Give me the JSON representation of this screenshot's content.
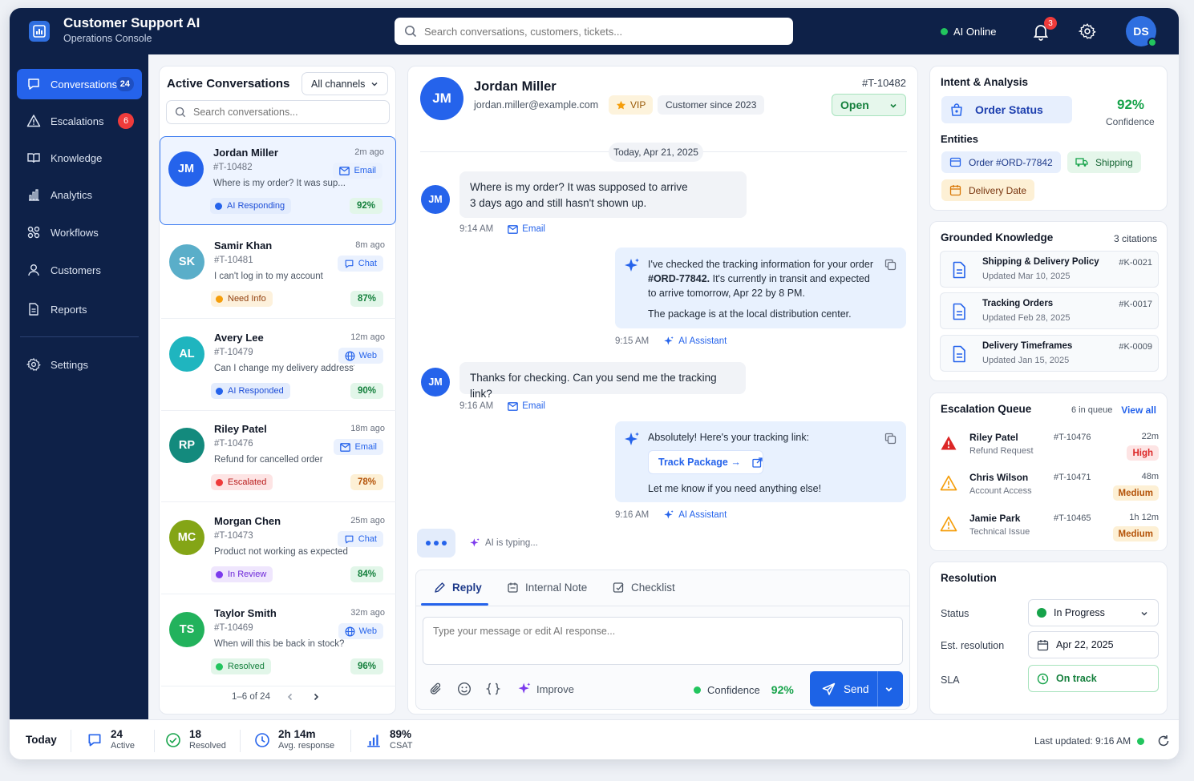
{
  "app": {
    "title": "Customer Support AI",
    "subtitle": "Operations Console"
  },
  "search": {
    "placeholder": "Search conversations, customers, tickets..."
  },
  "status": {
    "ai_label": "AI Online",
    "notifications_count": "3",
    "user_initials": "DS"
  },
  "sidebar": {
    "items": [
      {
        "label": "Conversations",
        "count": "24",
        "icon": "chat-bubble-icon",
        "active": true
      },
      {
        "label": "Escalations",
        "count": "6",
        "icon": "warning-icon"
      },
      {
        "label": "Knowledge",
        "icon": "book-icon"
      },
      {
        "label": "Analytics",
        "icon": "bar-chart-icon"
      },
      {
        "label": "Workflows",
        "icon": "workflow-icon"
      },
      {
        "label": "Customers",
        "icon": "user-icon"
      },
      {
        "label": "Reports",
        "icon": "document-icon"
      },
      {
        "label": "Settings",
        "icon": "gear-icon"
      }
    ]
  },
  "conversations": {
    "title": "Active Conversations",
    "channel_filter": "All channels",
    "search_placeholder": "Search conversations...",
    "pager": "1–6 of 24",
    "items": [
      {
        "initials": "JM",
        "name": "Jordan Miller",
        "time": "2m ago",
        "id": "#T-10482",
        "message": "Where is my order? It was sup...",
        "channel": "Email",
        "status": "AI Responding",
        "score": "92%",
        "avatar_color": "#2563eb",
        "status_color": "#2563eb",
        "status_bg": "#e3ecfd",
        "status_text": "#1d4ed8"
      },
      {
        "initials": "SK",
        "name": "Samir Khan",
        "time": "8m ago",
        "id": "#T-10481",
        "message": "I can't log in to my account",
        "channel": "Chat",
        "status": "Need Info",
        "score": "87%",
        "avatar_color": "#5aaec9",
        "status_color": "#f59e0b",
        "status_bg": "#fdf1dc",
        "status_text": "#92400e"
      },
      {
        "initials": "AL",
        "name": "Avery Lee",
        "time": "12m ago",
        "id": "#T-10479",
        "message": "Can I change my delivery address?",
        "channel": "Web",
        "status": "AI Responded",
        "score": "90%",
        "avatar_color": "#1fb5bf",
        "status_color": "#2563eb",
        "status_bg": "#e3ecfd",
        "status_text": "#1d4ed8"
      },
      {
        "initials": "RP",
        "name": "Riley Patel",
        "time": "18m ago",
        "id": "#T-10476",
        "message": "Refund for cancelled order",
        "channel": "Email",
        "status": "Escalated",
        "score": "78%",
        "avatar_color": "#138a7d",
        "status_color": "#ef3b3b",
        "status_bg": "#fde4e4",
        "status_text": "#b91c1c"
      },
      {
        "initials": "MC",
        "name": "Morgan Chen",
        "time": "25m ago",
        "id": "#T-10473",
        "message": "Product not working as expected",
        "channel": "Chat",
        "status": "In Review",
        "score": "84%",
        "avatar_color": "#84a516",
        "status_color": "#7c3aed",
        "status_bg": "#efe6fd",
        "status_text": "#6d28d9"
      },
      {
        "initials": "TS",
        "name": "Taylor Smith",
        "time": "32m ago",
        "id": "#T-10469",
        "message": "When will this be back in stock?",
        "channel": "Web",
        "status": "Resolved",
        "score": "96%",
        "avatar_color": "#22b25c",
        "status_color": "#22c55e",
        "status_bg": "#e2f6e9",
        "status_text": "#15803d"
      }
    ]
  },
  "chat": {
    "customer_initials": "JM",
    "customer_name": "Jordan Miller",
    "customer_email": "jordan.miller@example.com",
    "vip_label": "VIP",
    "since_label": "Customer since 2023",
    "ticket_id": "#T-10482",
    "status_label": "Open",
    "date_divider": "Today, Apr 21, 2025",
    "messages": [
      {
        "line1": "Where is my order? It was supposed to arrive",
        "line2": "3 days ago and still hasn't shown up.",
        "time": "9:14 AM",
        "channel": "Email"
      },
      {
        "line1": "I've checked the tracking information for your order",
        "line2_bold": "#ORD-77842.",
        "line2_rest": " It's currently in transit and expected",
        "line3": "to arrive tomorrow, Apr 22 by 8 PM.",
        "line4": "The package is at the local distribution center.",
        "time": "9:15 AM",
        "channel": "AI Assistant"
      },
      {
        "line1": "Thanks for checking. Can you send me the tracking link?",
        "time": "9:16 AM",
        "channel": "Email"
      },
      {
        "line1": "Absolutely! Here's your tracking link:",
        "link": "Track Package →",
        "line2": "Let me know if you need anything else!",
        "time": "9:16 AM",
        "channel": "AI Assistant"
      }
    ],
    "typing_label": "AI is typing...",
    "composer": {
      "tabs": [
        "Reply",
        "Internal Note",
        "Checklist"
      ],
      "placeholder": "Type your message or edit AI response...",
      "improve_label": "Improve",
      "confidence_label": "Confidence",
      "confidence_value": "92%",
      "send_label": "Send"
    }
  },
  "intent": {
    "title": "Intent & Analysis",
    "intent_label": "Order Status",
    "confidence": "92%",
    "confidence_label": "Confidence",
    "entities_label": "Entities",
    "entities": [
      "Order #ORD-77842",
      "Shipping",
      "Delivery Date"
    ]
  },
  "knowledge": {
    "title": "Grounded Knowledge",
    "citations": "3 citations",
    "items": [
      {
        "title": "Shipping & Delivery Policy",
        "updated": "Updated Mar 10, 2025",
        "id": "#K-0021"
      },
      {
        "title": "Tracking Orders",
        "updated": "Updated Feb 28, 2025",
        "id": "#K-0017"
      },
      {
        "title": "Delivery Timeframes",
        "updated": "Updated Jan 15, 2025",
        "id": "#K-0009"
      }
    ]
  },
  "escalation": {
    "title": "Escalation Queue",
    "count": "6 in queue",
    "view_all": "View all",
    "items": [
      {
        "name": "Riley Patel",
        "type": "Refund Request",
        "id": "#T-10476",
        "time": "22m",
        "priority": "High",
        "color": "#dc2626",
        "bg": "#fde4e4"
      },
      {
        "name": "Chris Wilson",
        "type": "Account Access",
        "id": "#T-10471",
        "time": "48m",
        "priority": "Medium",
        "color": "#b45309",
        "bg": "#fdf0d5"
      },
      {
        "name": "Jamie Park",
        "type": "Technical Issue",
        "id": "#T-10465",
        "time": "1h 12m",
        "priority": "Medium",
        "color": "#b45309",
        "bg": "#fdf0d5"
      }
    ]
  },
  "resolution": {
    "title": "Resolution",
    "status_label": "Status",
    "status_value": "In Progress",
    "est_label": "Est. resolution",
    "est_value": "Apr 22, 2025",
    "sla_label": "SLA",
    "sla_value": "On track"
  },
  "footer": {
    "today_label": "Today",
    "stats": [
      {
        "value": "24",
        "label": "Active"
      },
      {
        "value": "18",
        "label": "Resolved"
      },
      {
        "value": "2h 14m",
        "label": "Avg. response"
      },
      {
        "value": "89%",
        "label": "CSAT"
      }
    ],
    "last_updated": "Last updated: 9:16 AM"
  },
  "colors": {
    "brand_navy": "#0e2148",
    "accent_blue": "#2563eb",
    "success": "#16a34a",
    "danger": "#ef3b3b"
  }
}
